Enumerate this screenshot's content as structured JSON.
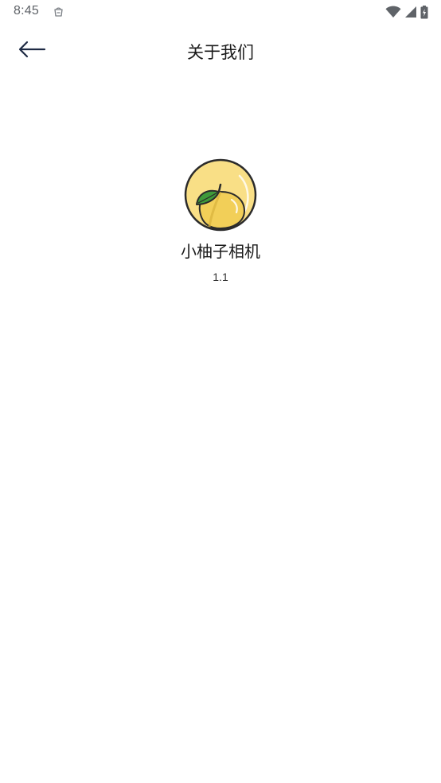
{
  "status_bar": {
    "time": "8:45",
    "icons": [
      "notification-bag-icon",
      "wifi-icon",
      "cellular-signal-icon",
      "battery-charging-icon"
    ]
  },
  "header": {
    "title": "关于我们",
    "back_icon": "arrow-left-icon"
  },
  "about": {
    "app_name": "小柚子相机",
    "version": "1.1",
    "logo": "pomelo-fruit-logo"
  },
  "colors": {
    "background": "#ffffff",
    "logo_yellow": "#f7dc82",
    "leaf_green": "#3f9a3a",
    "text": "#1a1a1a",
    "status_gray": "#5f6368"
  }
}
